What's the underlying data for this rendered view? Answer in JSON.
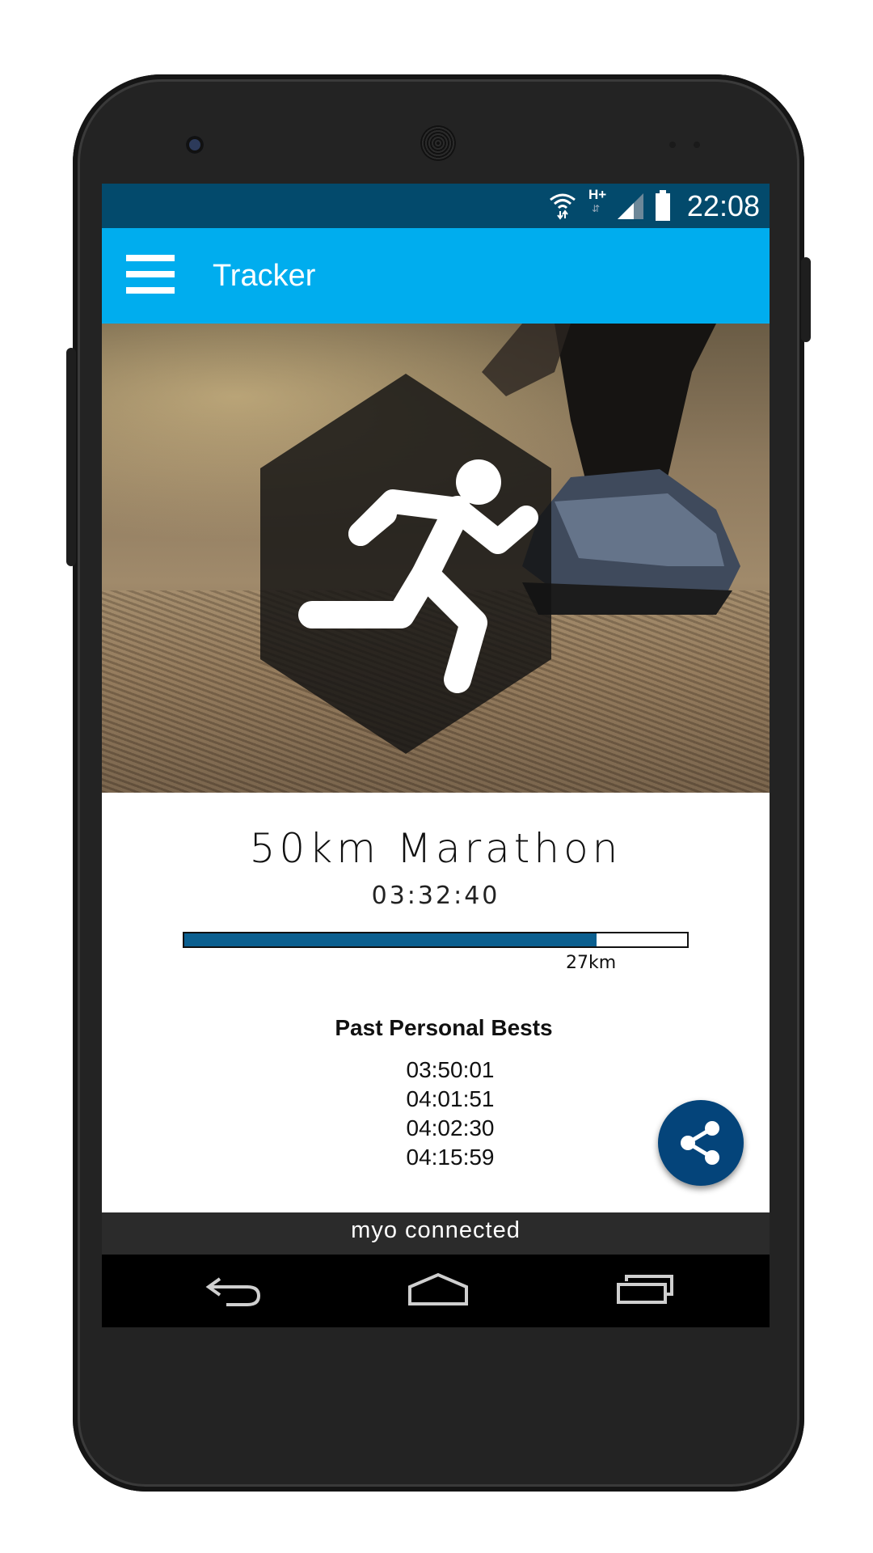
{
  "status_bar": {
    "time": "22:08",
    "network_label": "H+",
    "icons": [
      "wifi-icon",
      "network-type-icon",
      "signal-icon",
      "battery-icon"
    ]
  },
  "app_bar": {
    "title": "Tracker",
    "menu_icon": "menu-icon"
  },
  "hero": {
    "icon": "running-person-icon"
  },
  "race": {
    "title": "50km Marathon",
    "elapsed": "03:32:40",
    "progress_fraction": 0.82,
    "distance_label": "27km"
  },
  "personal_bests": {
    "title": "Past Personal Bests",
    "times": [
      "03:50:01",
      "04:01:51",
      "04:02:30",
      "04:15:59"
    ]
  },
  "share_button": {
    "icon": "share-icon"
  },
  "connection": {
    "status": "myo connected"
  },
  "nav_bar": {
    "icons": [
      "back-icon",
      "home-icon",
      "recents-icon"
    ]
  },
  "colors": {
    "status_bar": "#034a6c",
    "app_bar": "#00adee",
    "progress_fill": "#0b5f8f",
    "fab": "#04447a",
    "connection_bar": "#2b2b2b"
  }
}
